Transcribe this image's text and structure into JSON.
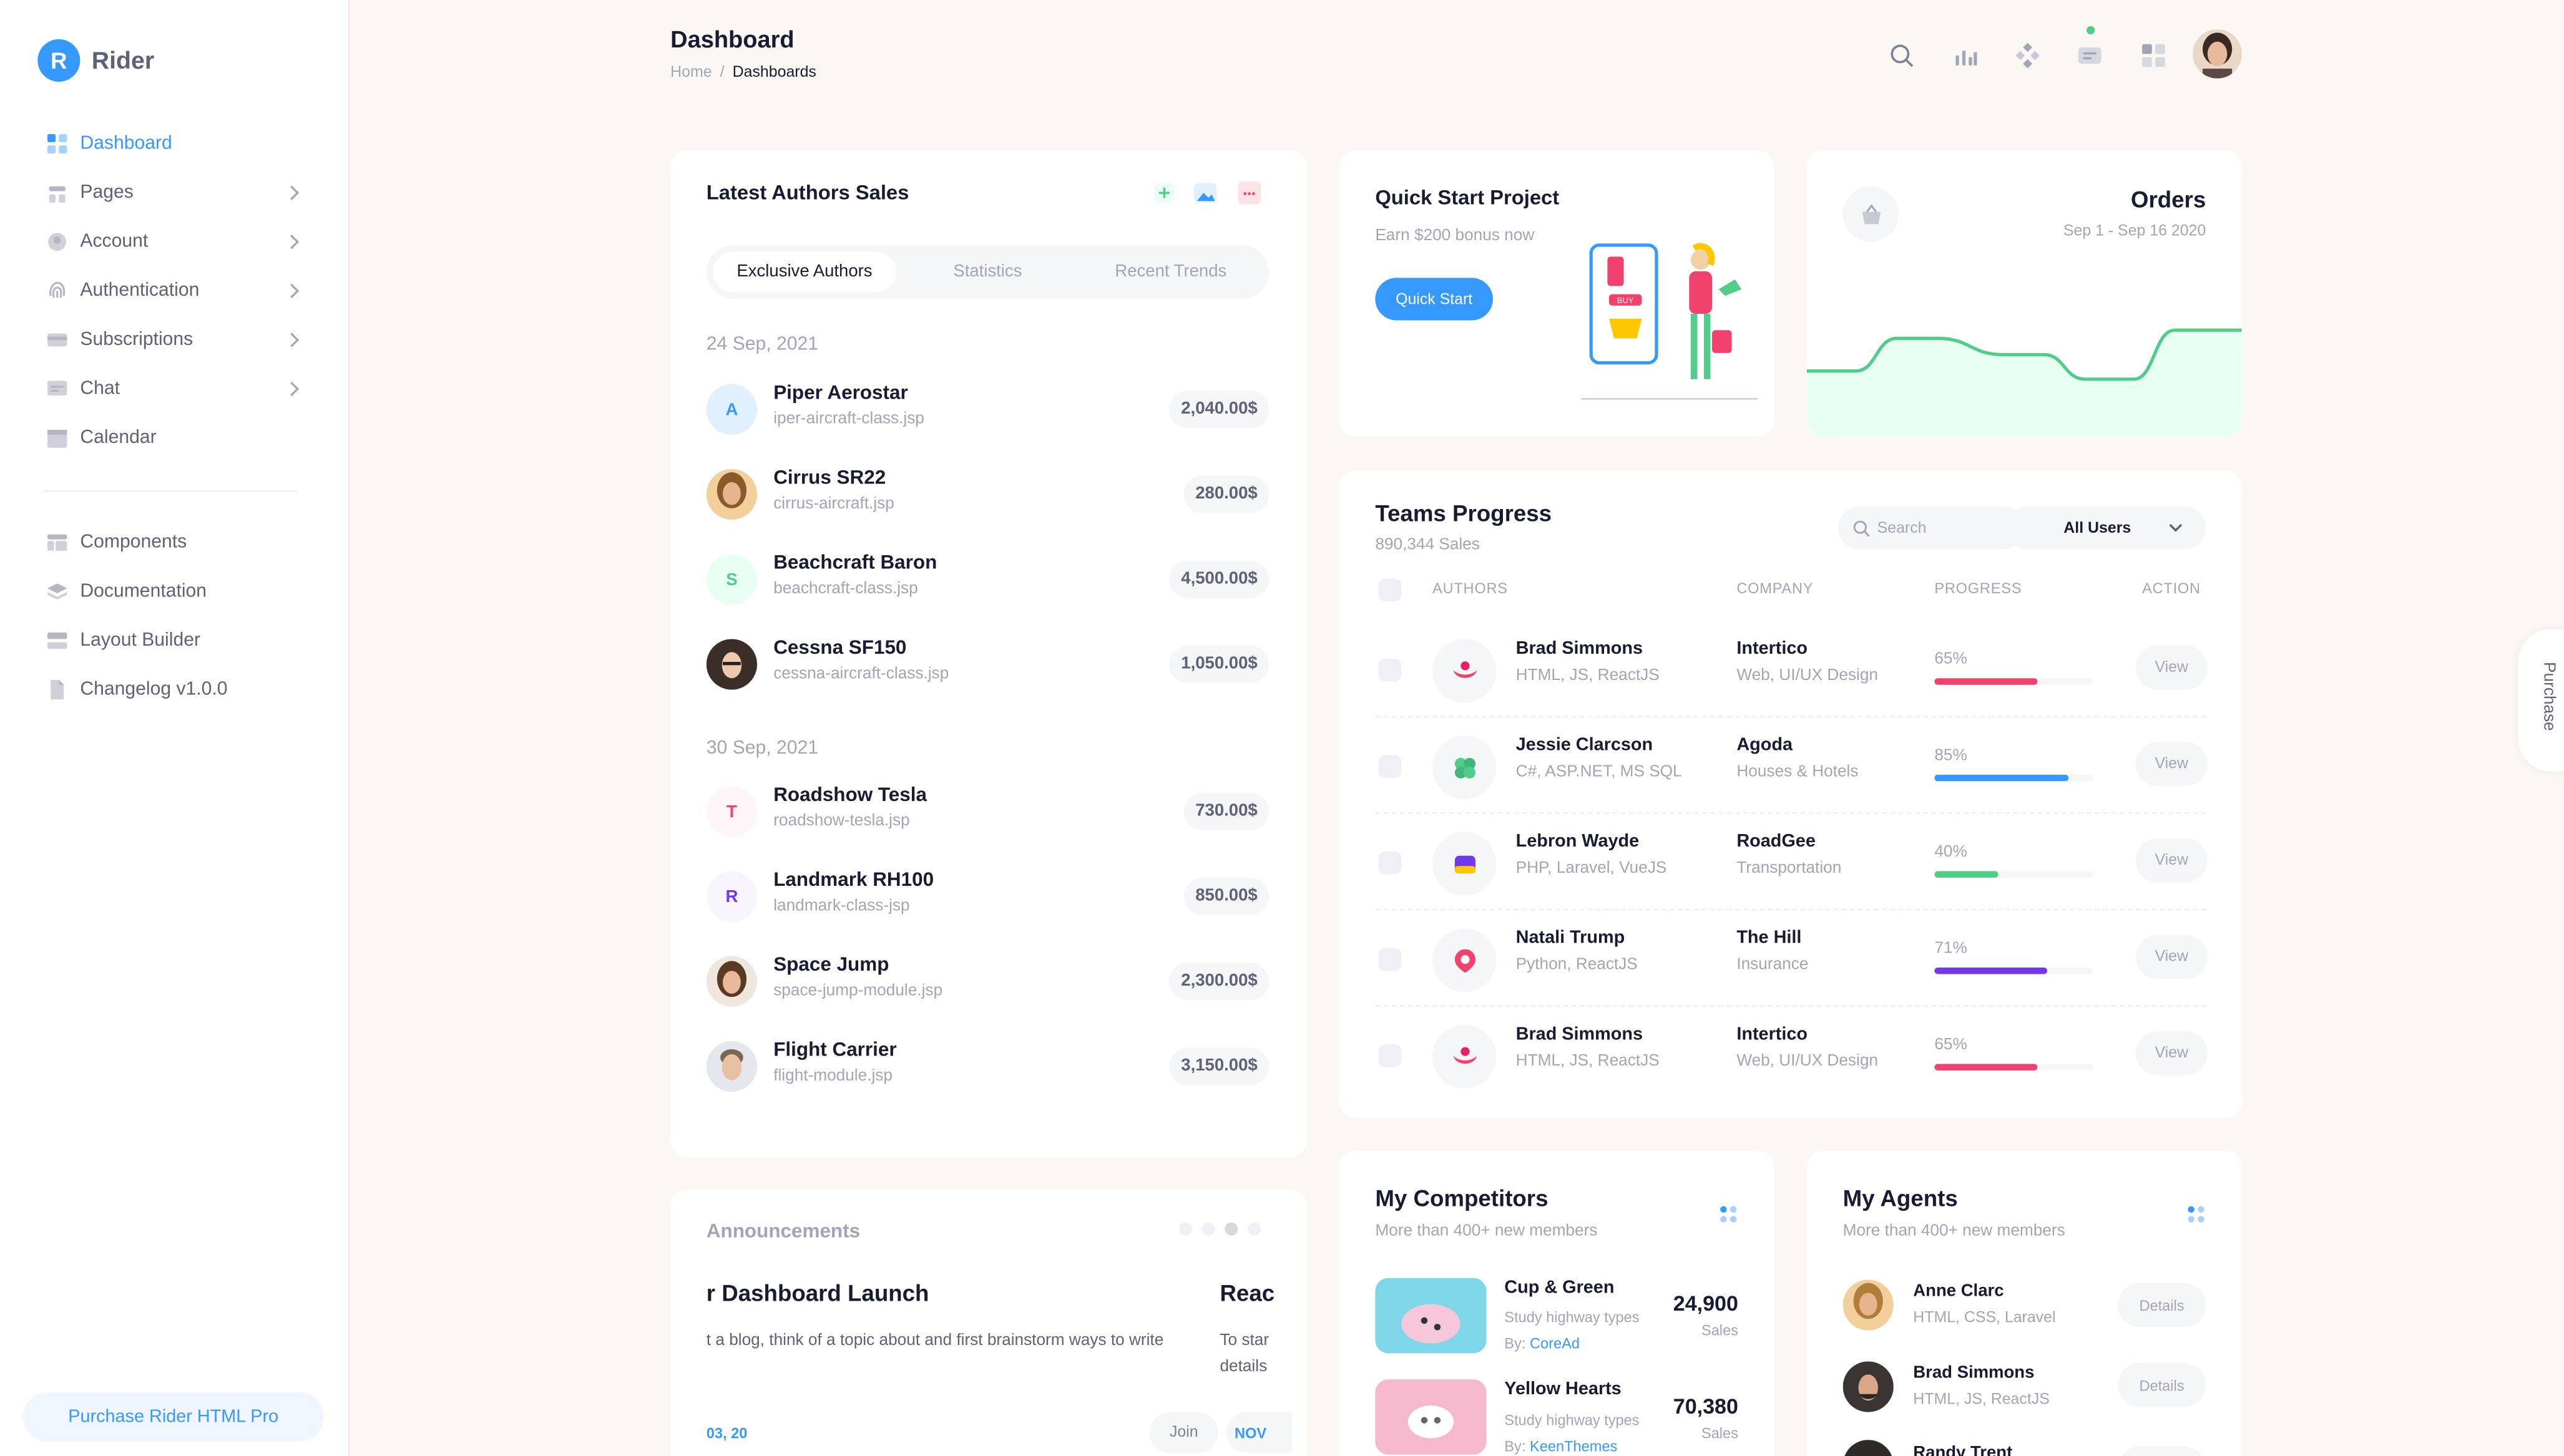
{
  "brand": {
    "logo_letter": "R",
    "name": "Rider",
    "accent": "#3699ff"
  },
  "sidebar": {
    "items": [
      {
        "label": "Dashboard",
        "icon": "dashboard-icon",
        "active": true
      },
      {
        "label": "Pages",
        "icon": "pages-icon",
        "has_children": true
      },
      {
        "label": "Account",
        "icon": "account-icon",
        "has_children": true
      },
      {
        "label": "Authentication",
        "icon": "fingerprint-icon",
        "has_children": true
      },
      {
        "label": "Subscriptions",
        "icon": "credit-card-icon",
        "has_children": true
      },
      {
        "label": "Chat",
        "icon": "chat-icon",
        "has_children": true
      },
      {
        "label": "Calendar",
        "icon": "calendar-icon"
      }
    ],
    "items2": [
      {
        "label": "Components",
        "icon": "components-icon"
      },
      {
        "label": "Documentation",
        "icon": "layers-icon"
      },
      {
        "label": "Layout Builder",
        "icon": "layout-icon"
      },
      {
        "label": "Changelog v1.0.0",
        "icon": "file-icon"
      }
    ],
    "purchase_label": "Purchase Rider HTML Pro"
  },
  "header": {
    "title": "Dashboard",
    "breadcrumb": [
      "Home",
      "/",
      "Dashboards"
    ]
  },
  "authors": {
    "title": "Latest Authors Sales",
    "tabs": [
      "Exclusive Authors",
      "Statistics",
      "Recent Trends"
    ],
    "groups": [
      {
        "date": "24 Sep, 2021",
        "rows": [
          {
            "name": "Piper Aerostar",
            "file": "iper-aircraft-class.jsp",
            "amount": "2,040.00$",
            "initial": "A"
          },
          {
            "name": "Cirrus SR22",
            "file": "cirrus-aircraft.jsp",
            "amount": "280.00$"
          },
          {
            "name": "Beachcraft Baron",
            "file": "beachcraft-class.jsp",
            "amount": "4,500.00$",
            "initial": "S"
          },
          {
            "name": "Cessna SF150",
            "file": "cessna-aircraft-class.jsp",
            "amount": "1,050.00$"
          }
        ]
      },
      {
        "date": "30 Sep, 2021",
        "rows": [
          {
            "name": "Roadshow Tesla",
            "file": "roadshow-tesla.jsp",
            "amount": "730.00$",
            "initial": "T"
          },
          {
            "name": "Landmark RH100",
            "file": "landmark-class-jsp",
            "amount": "850.00$",
            "initial": "R"
          },
          {
            "name": "Space Jump",
            "file": "space-jump-module.jsp",
            "amount": "2,300.00$"
          },
          {
            "name": "Flight Carrier",
            "file": "flight-module.jsp",
            "amount": "3,150.00$"
          }
        ]
      }
    ]
  },
  "announcements": {
    "title": "Announcements",
    "headline": "r Dashboard Launch",
    "headline_next": "Reac",
    "text": "t a blog, think of a topic about and first brainstorm ways to write",
    "text_next_1": "To star",
    "text_next_2": "details",
    "date": "03, 20",
    "join_label": "Join",
    "badge": "NOV"
  },
  "quick_start": {
    "title": "Quick Start Project",
    "subtitle": "Earn $200 bonus now",
    "button": "Quick Start",
    "illustration_text": "BUY"
  },
  "orders": {
    "title": "Orders",
    "range": "Sep 1 - Sep 16 2020",
    "trend": [
      0.3,
      0.3,
      0.7,
      0.7,
      0.5,
      0.5,
      0.2,
      0.2,
      0.8,
      0.8
    ]
  },
  "teams": {
    "title": "Teams Progress",
    "subtitle": "890,344 Sales",
    "search_placeholder": "Search",
    "filter": "All Users",
    "headers": [
      "AUTHORS",
      "COMPANY",
      "PROGRESS",
      "ACTION"
    ],
    "rows": [
      {
        "name": "Brad Simmons",
        "skills": "HTML, JS, ReactJS",
        "company": "Intertico",
        "company_sub": "Web, UI/UX Design",
        "pct": "65%",
        "progress": 0.65,
        "color": "#f1416c",
        "logo": "intertico-logo-icon"
      },
      {
        "name": "Jessie Clarcson",
        "skills": "C#, ASP.NET, MS SQL",
        "company": "Agoda",
        "company_sub": "Houses & Hotels",
        "pct": "85%",
        "progress": 0.85,
        "color": "#3699ff",
        "logo": "agoda-logo-icon"
      },
      {
        "name": "Lebron Wayde",
        "skills": "PHP, Laravel, VueJS",
        "company": "RoadGee",
        "company_sub": "Transportation",
        "pct": "40%",
        "progress": 0.4,
        "color": "#50cd89",
        "logo": "roadgee-logo-icon"
      },
      {
        "name": "Natali Trump",
        "skills": "Python, ReactJS",
        "company": "The Hill",
        "company_sub": "Insurance",
        "pct": "71%",
        "progress": 0.71,
        "color": "#7239ea",
        "logo": "the-hill-logo-icon"
      },
      {
        "name": "Brad Simmons",
        "skills": "HTML, JS, ReactJS",
        "company": "Intertico",
        "company_sub": "Web, UI/UX Design",
        "pct": "65%",
        "progress": 0.65,
        "color": "#f1416c",
        "logo": "intertico-logo-icon"
      }
    ],
    "view_label": "View"
  },
  "competitors": {
    "title": "My Competitors",
    "subtitle": "More than 400+ new members",
    "rows": [
      {
        "name": "Cup & Green",
        "desc": "Study highway types",
        "by_label": "By:",
        "by": "CoreAd",
        "value": "24,900",
        "label": "Sales"
      },
      {
        "name": "Yellow Hearts",
        "desc": "Study highway types",
        "by_label": "By:",
        "by": "KeenThemes",
        "value": "70,380",
        "label": "Sales"
      }
    ]
  },
  "agents": {
    "title": "My Agents",
    "subtitle": "More than 400+ new members",
    "rows": [
      {
        "name": "Anne Clarc",
        "skills": "HTML, CSS, Laravel",
        "button": "Details"
      },
      {
        "name": "Brad Simmons",
        "skills": "HTML, JS, ReactJS",
        "button": "Details"
      },
      {
        "name": "Randy Trent",
        "skills": "",
        "button": ""
      }
    ]
  },
  "purchase_tab": "Purchase"
}
